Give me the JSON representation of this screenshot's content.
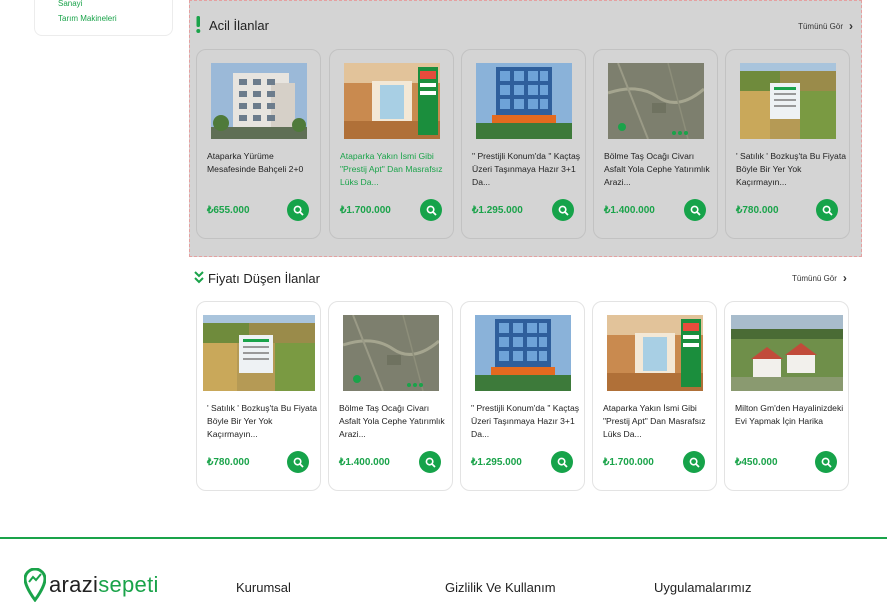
{
  "sidebar": {
    "items": [
      "Sanayi",
      "Tarım Makineleri"
    ]
  },
  "urgent": {
    "title": "Acil İlanlar",
    "see_all": "Tümünü Gör",
    "listings": [
      {
        "title": "Ataparka Yürüme Mesafesinde Bahçeli 2+0",
        "price": "₺655.000",
        "image": "apartment-building-photo"
      },
      {
        "title": "Ataparka Yakın İsmi Gibi \"Prestij Apt\" Dan Masrafsız Lüks Da...",
        "price": "₺1.700.000",
        "image": "apartment-interior-photo"
      },
      {
        "title": "\" Prestijli Konum'da \" Kaçtaş Üzeri Taşınmaya Hazır 3+1 Da...",
        "price": "₺1.295.000",
        "image": "glass-building-photo"
      },
      {
        "title": "Bölme Taş Ocağı Civarı Asfalt Yola Cephe Yatırımlık Arazi...",
        "price": "₺1.400.000",
        "image": "aerial-land-map"
      },
      {
        "title": "' Satılık ' Bozkuş'ta Bu Fiyata Böyle Bir Yer Yok Kaçırmayın...",
        "price": "₺780.000",
        "image": "aerial-field-photo"
      }
    ]
  },
  "price_drop": {
    "title": "Fiyatı Düşen İlanlar",
    "see_all": "Tümünü Gör",
    "listings": [
      {
        "title": "' Satılık ' Bozkuş'ta Bu Fiyata Böyle Bir Yer Yok Kaçırmayın...",
        "price": "₺780.000",
        "image": "aerial-field-photo"
      },
      {
        "title": "Bölme Taş Ocağı Civarı Asfalt Yola Cephe Yatırımlık Arazi...",
        "price": "₺1.400.000",
        "image": "aerial-land-map"
      },
      {
        "title": "\" Prestijli Konum'da \" Kaçtaş Üzeri Taşınmaya Hazır 3+1 Da...",
        "price": "₺1.295.000",
        "image": "glass-building-photo"
      },
      {
        "title": "Ataparka Yakın İsmi Gibi \"Prestij Apt\" Dan Masrafsız Lüks Da...",
        "price": "₺1.700.000",
        "image": "apartment-interior-photo"
      },
      {
        "title": "Milton Gm'den Hayalinizdeki Evi Yapmak İçin Harika",
        "price": "₺450.000",
        "image": "village-houses-photo"
      }
    ]
  },
  "footer": {
    "logo_dark": "arazi",
    "logo_green": "sepeti",
    "columns": [
      "Kurumsal",
      "Gizlilik Ve Kullanım",
      "Uygulamalarımız"
    ]
  },
  "colors": {
    "brand_green": "#1aa34a",
    "urgent_bg": "#d4d4d4"
  }
}
